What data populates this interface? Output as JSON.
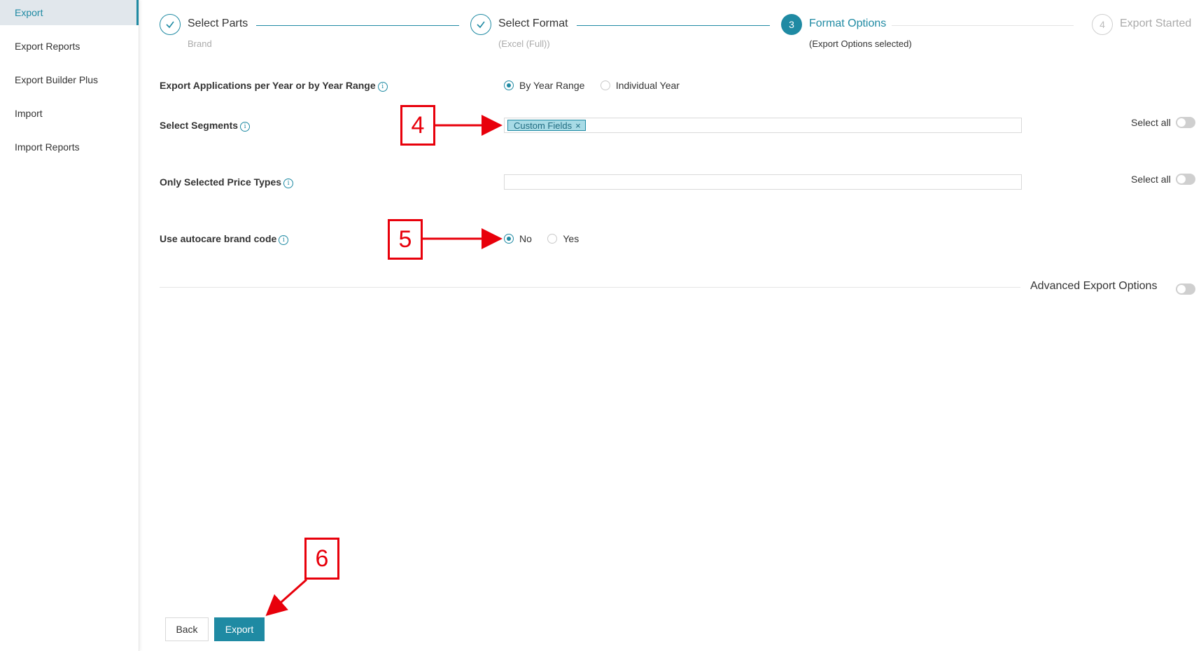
{
  "sidebar": {
    "items": [
      {
        "label": "Export",
        "active": true
      },
      {
        "label": "Export Reports"
      },
      {
        "label": "Export Builder Plus"
      },
      {
        "label": "Import"
      },
      {
        "label": "Import Reports"
      }
    ]
  },
  "steps": [
    {
      "number": "1",
      "title": "Select Parts",
      "subtitle": "Brand",
      "state": "done"
    },
    {
      "number": "2",
      "title": "Select Format",
      "subtitle": "(Excel (Full))",
      "state": "done"
    },
    {
      "number": "3",
      "title": "Format Options",
      "subtitle": "(Export Options selected)",
      "state": "active"
    },
    {
      "number": "4",
      "title": "Export Started",
      "subtitle": "",
      "state": "todo"
    }
  ],
  "form": {
    "year_mode": {
      "label": "Export Applications per Year or by Year Range",
      "options": [
        "By Year Range",
        "Individual Year"
      ],
      "selected": "By Year Range"
    },
    "segments": {
      "label": "Select Segments",
      "tags": [
        "Custom Fields"
      ],
      "select_all_label": "Select all"
    },
    "price_types": {
      "label": "Only Selected Price Types",
      "value": "",
      "select_all_label": "Select all"
    },
    "autocare": {
      "label": "Use autocare brand code",
      "options": [
        "No",
        "Yes"
      ],
      "selected": "No"
    },
    "advanced_label": "Advanced Export Options"
  },
  "buttons": {
    "back": "Back",
    "export": "Export"
  },
  "annotations": [
    "4",
    "5",
    "6"
  ],
  "colors": {
    "accent": "#1f8aa3",
    "annotation": "#e8000b"
  }
}
